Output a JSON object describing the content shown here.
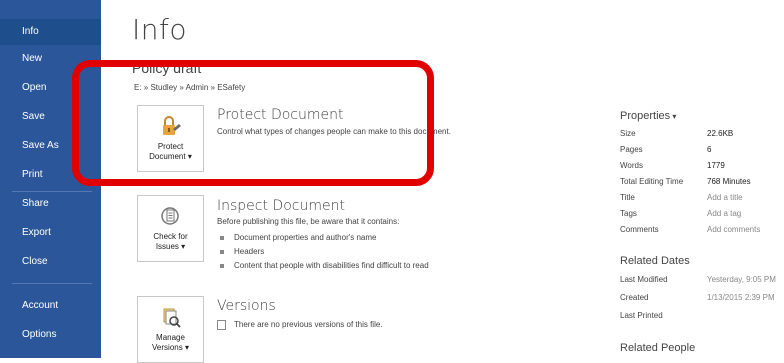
{
  "sidebar": {
    "items": [
      {
        "label": "Info",
        "active": true
      },
      {
        "label": "New"
      },
      {
        "label": "Open"
      },
      {
        "label": "Save"
      },
      {
        "label": "Save As"
      },
      {
        "label": "Print"
      },
      {
        "label": "Share"
      },
      {
        "label": "Export"
      },
      {
        "label": "Close"
      },
      {
        "label": "Account"
      },
      {
        "label": "Options"
      }
    ]
  },
  "main": {
    "title": "Info",
    "doc_name": "Policy draft",
    "path": [
      "E:",
      "Studley",
      "Admin",
      "ESafety"
    ],
    "path_sep": " » ",
    "protect": {
      "button_label_1": "Protect",
      "button_label_2": "Document",
      "title": "Protect Document",
      "desc": "Control what types of changes people can make to this document."
    },
    "inspect": {
      "button_label_1": "Check for",
      "button_label_2": "Issues",
      "title": "Inspect Document",
      "desc": "Before publishing this file, be aware that it contains:",
      "bullets": [
        "Document properties and author's name",
        "Headers",
        "Content that people with disabilities find difficult to read"
      ]
    },
    "versions": {
      "button_label_1": "Manage",
      "button_label_2": "Versions",
      "title": "Versions",
      "desc": "There are no previous versions of this file."
    }
  },
  "properties": {
    "header": "Properties",
    "rows": [
      {
        "label": "Size",
        "value": "22.6KB"
      },
      {
        "label": "Pages",
        "value": "6"
      },
      {
        "label": "Words",
        "value": "1779"
      },
      {
        "label": "Total Editing Time",
        "value": "768 Minutes"
      },
      {
        "label": "Title",
        "value": "Add a title"
      },
      {
        "label": "Tags",
        "value": "Add a tag"
      },
      {
        "label": "Comments",
        "value": "Add comments"
      }
    ],
    "related_dates": {
      "header": "Related Dates",
      "rows": [
        {
          "label": "Last Modified",
          "value": "Yesterday, 9:05 PM"
        },
        {
          "label": "Created",
          "value": "1/13/2015 2:39 PM"
        },
        {
          "label": "Last Printed",
          "value": ""
        }
      ]
    },
    "related_people": {
      "header": "Related People"
    }
  },
  "colors": {
    "sidebar": "#2b579a",
    "annotation": "#e00000",
    "lock": "#e8a33a"
  }
}
